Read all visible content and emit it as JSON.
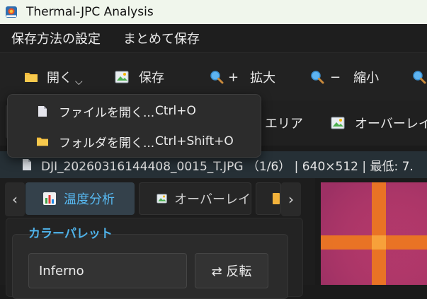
{
  "window": {
    "title": "Thermal-JPC Analysis",
    "icon_text": "Thermal-JPC"
  },
  "menubar": {
    "items": [
      "保存方法の設定",
      "まとめて保存"
    ]
  },
  "toolbar": {
    "open_label": "開く",
    "save_label": "保存",
    "zoom_in_label": "拡大",
    "zoom_in_sign": "+",
    "zoom_out_label": "縮小",
    "zoom_out_sign": "−"
  },
  "toolbar2": {
    "area_label": "エリア",
    "overlay_label": "オーバーレイ"
  },
  "open_menu": {
    "items": [
      {
        "label": "ファイルを開く...",
        "shortcut": "Ctrl+O"
      },
      {
        "label": "フォルダを開く...",
        "shortcut": "Ctrl+Shift+O"
      }
    ]
  },
  "infobar": {
    "text": "DJI_20260316144408_0015_T.JPG （1/6） | 640×512 | 最低: 7."
  },
  "tabs": {
    "prev": "‹",
    "next": "›",
    "items": [
      "温度分析",
      "オーバーレイ"
    ]
  },
  "palette": {
    "group_title": "カラーパレット",
    "selected": "Inferno",
    "reverse_label": "⇄ 反転"
  },
  "colors": {
    "accent": "#4fb3ea",
    "thermal_bg": "#b0376a",
    "thermal_line": "#f07a1e"
  }
}
